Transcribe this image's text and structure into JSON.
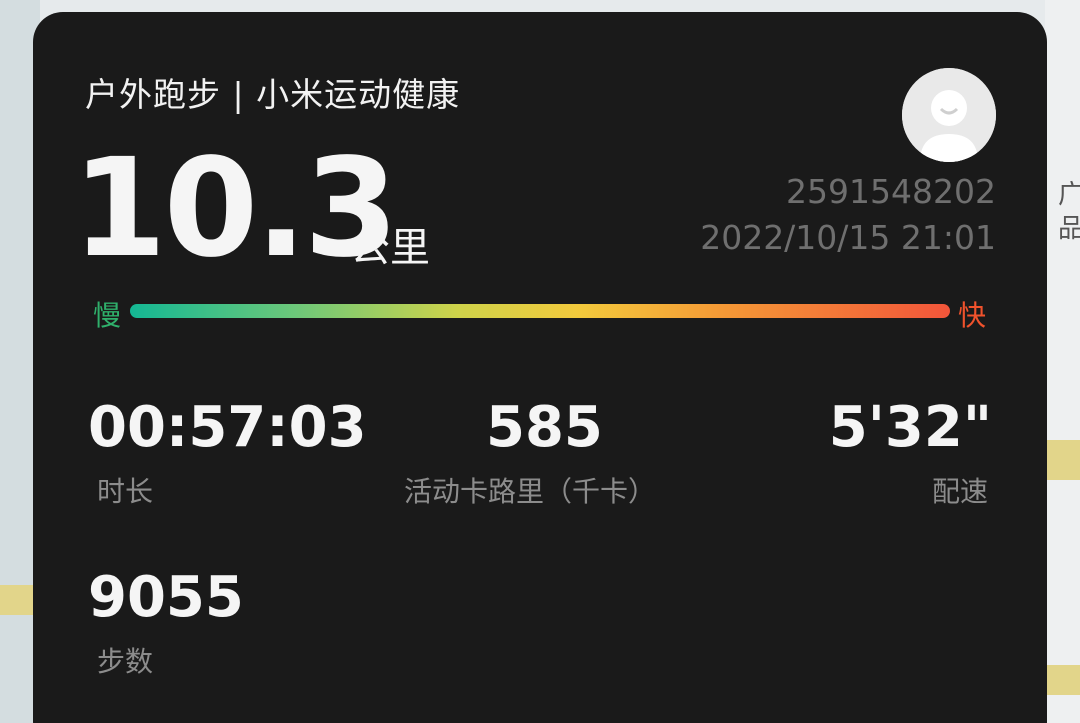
{
  "map": {
    "side_text": "广\n品"
  },
  "card": {
    "title": "户外跑步 | 小米运动健康",
    "distance": {
      "value": "10.3",
      "unit": "公里"
    },
    "user": {
      "avatar_icon": "default-avatar-icon",
      "id": "2591548202",
      "datetime": "2022/10/15 21:01"
    },
    "speed_legend": {
      "slow_label": "慢",
      "fast_label": "快",
      "slow_color": "#2fb06b",
      "fast_color": "#f0522c"
    },
    "stats": {
      "duration": {
        "value": "00:57:03",
        "label": "时长"
      },
      "calories": {
        "value": "585",
        "label": "活动卡路里（千卡）"
      },
      "pace": {
        "value": "5'32\"",
        "label": "配速"
      },
      "steps": {
        "value": "9055",
        "label": "步数"
      }
    }
  }
}
